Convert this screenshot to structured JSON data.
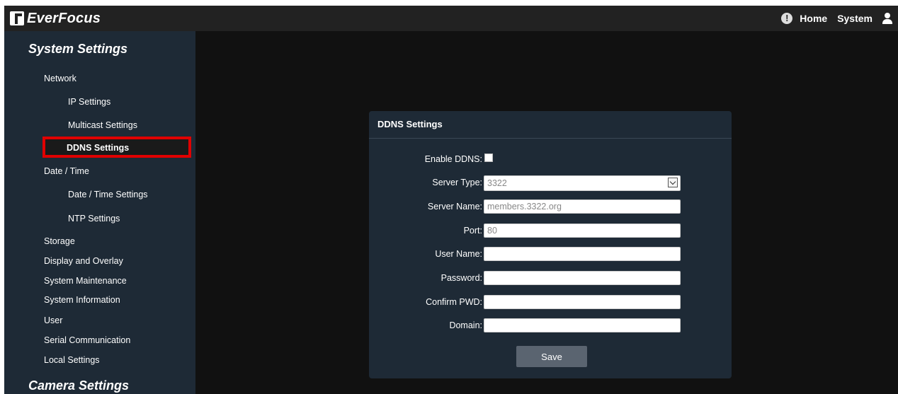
{
  "header": {
    "logo_text": "EverFocus",
    "nav": {
      "home": "Home",
      "system": "System"
    },
    "alert_icon_glyph": "!"
  },
  "sidebar": {
    "section_system": "System Settings",
    "items": [
      "Network",
      "IP Settings",
      "Multicast Settings",
      "DDNS Settings",
      "Date / Time",
      "Date / Time Settings",
      "NTP Settings",
      "Storage",
      "Display and Overlay",
      "System Maintenance",
      "System Information",
      "User",
      "Serial Communication",
      "Local Settings"
    ],
    "selected_item": "DDNS Settings",
    "section_camera": "Camera Settings"
  },
  "panel": {
    "title": "DDNS Settings",
    "enable_label": "Enable DDNS:",
    "enable_checked": false,
    "server_type_label": "Server Type:",
    "server_type_value": "3322",
    "server_name_label": "Server Name:",
    "server_name_value": "members.3322.org",
    "port_label": "Port:",
    "port_value": "80",
    "user_name_label": "User Name:",
    "user_name_value": "",
    "password_label": "Password:",
    "password_value": "",
    "confirm_label": "Confirm PWD:",
    "confirm_value": "",
    "domain_label": "Domain:",
    "domain_value": "",
    "save_label": "Save"
  },
  "colors": {
    "header_bg": "#222222",
    "sidebar_bg": "#1e2a36",
    "content_bg": "#111111",
    "highlight_border": "#e00000",
    "button_bg": "#5a6470"
  }
}
